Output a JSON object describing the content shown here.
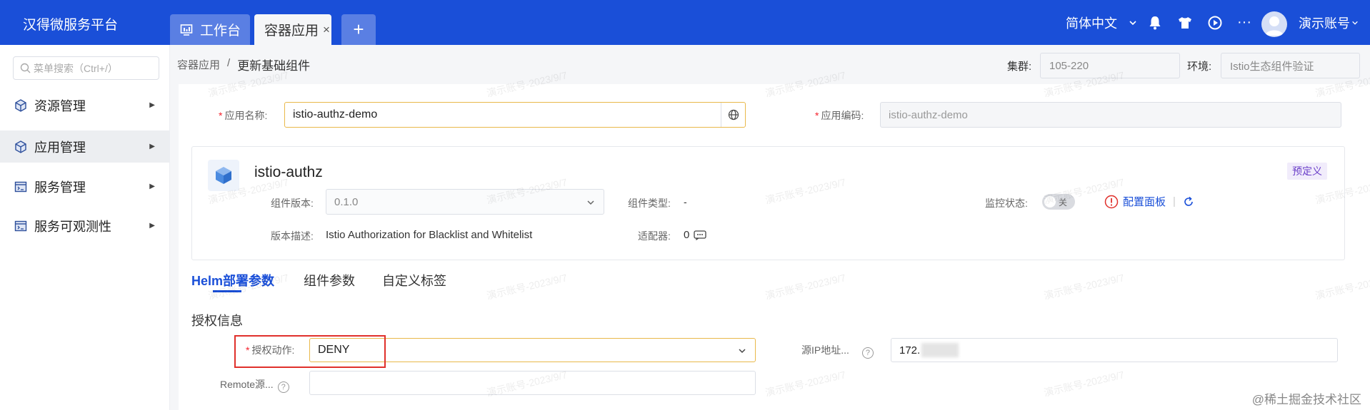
{
  "app": {
    "brand": "汉得微服务平台"
  },
  "tabs": [
    {
      "label": "工作台"
    },
    {
      "label": "容器应用",
      "close": "×"
    },
    {
      "label": "+"
    }
  ],
  "header": {
    "language": "简体中文",
    "more": "···",
    "user": "演示账号"
  },
  "sidebar": {
    "search_placeholder": "菜单搜索（Ctrl+/）",
    "items": [
      {
        "label": "资源管理",
        "icon": "cube-icon"
      },
      {
        "label": "应用管理",
        "icon": "cube-icon"
      },
      {
        "label": "服务管理",
        "icon": "service-icon"
      },
      {
        "label": "服务可观测性",
        "icon": "service-icon"
      }
    ]
  },
  "breadcrumb": {
    "parent": "容器应用",
    "separator": "/",
    "current": "更新基础组件"
  },
  "cluster": {
    "label": "集群:",
    "value": "105-220"
  },
  "environment": {
    "label": "环境:",
    "value": "Istio生态组件验证"
  },
  "form": {
    "app_name_label": "应用名称:",
    "app_name_value": "istio-authz-demo",
    "app_code_label": "应用编码:",
    "app_code_value": "istio-authz-demo",
    "required_mark": "*"
  },
  "component": {
    "name": "istio-authz",
    "badge": "预定义",
    "version_label": "组件版本:",
    "version_value": "0.1.0",
    "type_label": "组件类型:",
    "type_value": "-",
    "monitor_label": "监控状态:",
    "monitor_toggle": "关",
    "dashboard_link": "配置面板",
    "divider": "|",
    "desc_label": "版本描述:",
    "desc_value": "Istio Authorization for Blacklist and Whitelist",
    "adapter_label": "适配器:",
    "adapter_value": "0"
  },
  "section_tabs": [
    {
      "label": "Helm部署参数",
      "active": true
    },
    {
      "label": "组件参数",
      "active": false
    },
    {
      "label": "自定义标签",
      "active": false
    }
  ],
  "auth": {
    "section_title": "授权信息",
    "action_label": "授权动作:",
    "action_value": "DENY",
    "source_ip_label": "源IP地址...",
    "source_ip_value": "172.",
    "remote_label": "Remote源...",
    "help": "?"
  },
  "watermark": "演示账号-2023/9/7",
  "footer_mark": "@稀土掘金技术社区",
  "colors": {
    "primary": "#1a4fd8",
    "focus_border": "#e9b84a",
    "highlight": "#e0302b",
    "required": "#f5222d"
  }
}
